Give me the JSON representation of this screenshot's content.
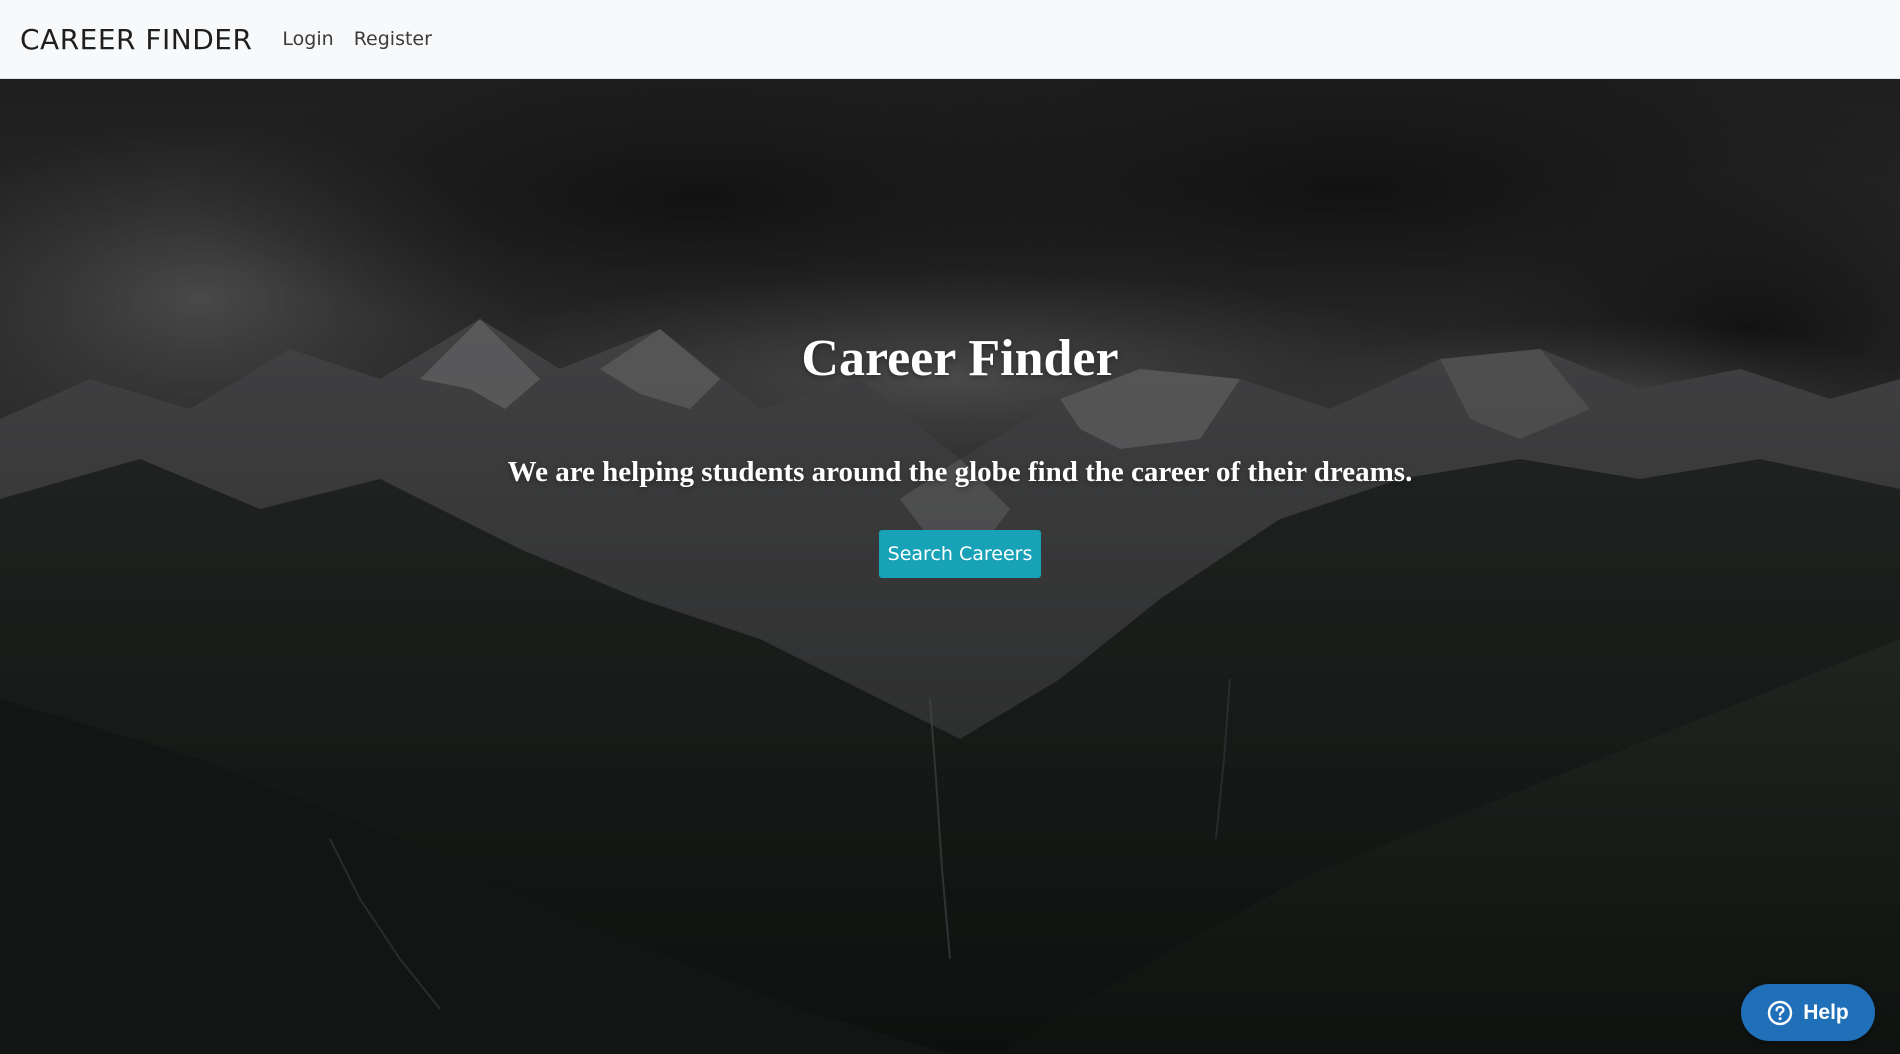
{
  "navbar": {
    "brand": "CAREER FINDER",
    "links": [
      {
        "label": "Login"
      },
      {
        "label": "Register"
      }
    ]
  },
  "hero": {
    "title": "Career Finder",
    "subtitle": "We are helping students around the globe find the career of their dreams.",
    "cta_label": "Search Careers",
    "background": "mountain-landscape-image"
  },
  "help_widget": {
    "label": "Help",
    "icon": "question-circle-icon"
  },
  "colors": {
    "accent": "#17a2b8",
    "help": "#1f70b8",
    "navbar_bg": "#f8f9fa"
  }
}
